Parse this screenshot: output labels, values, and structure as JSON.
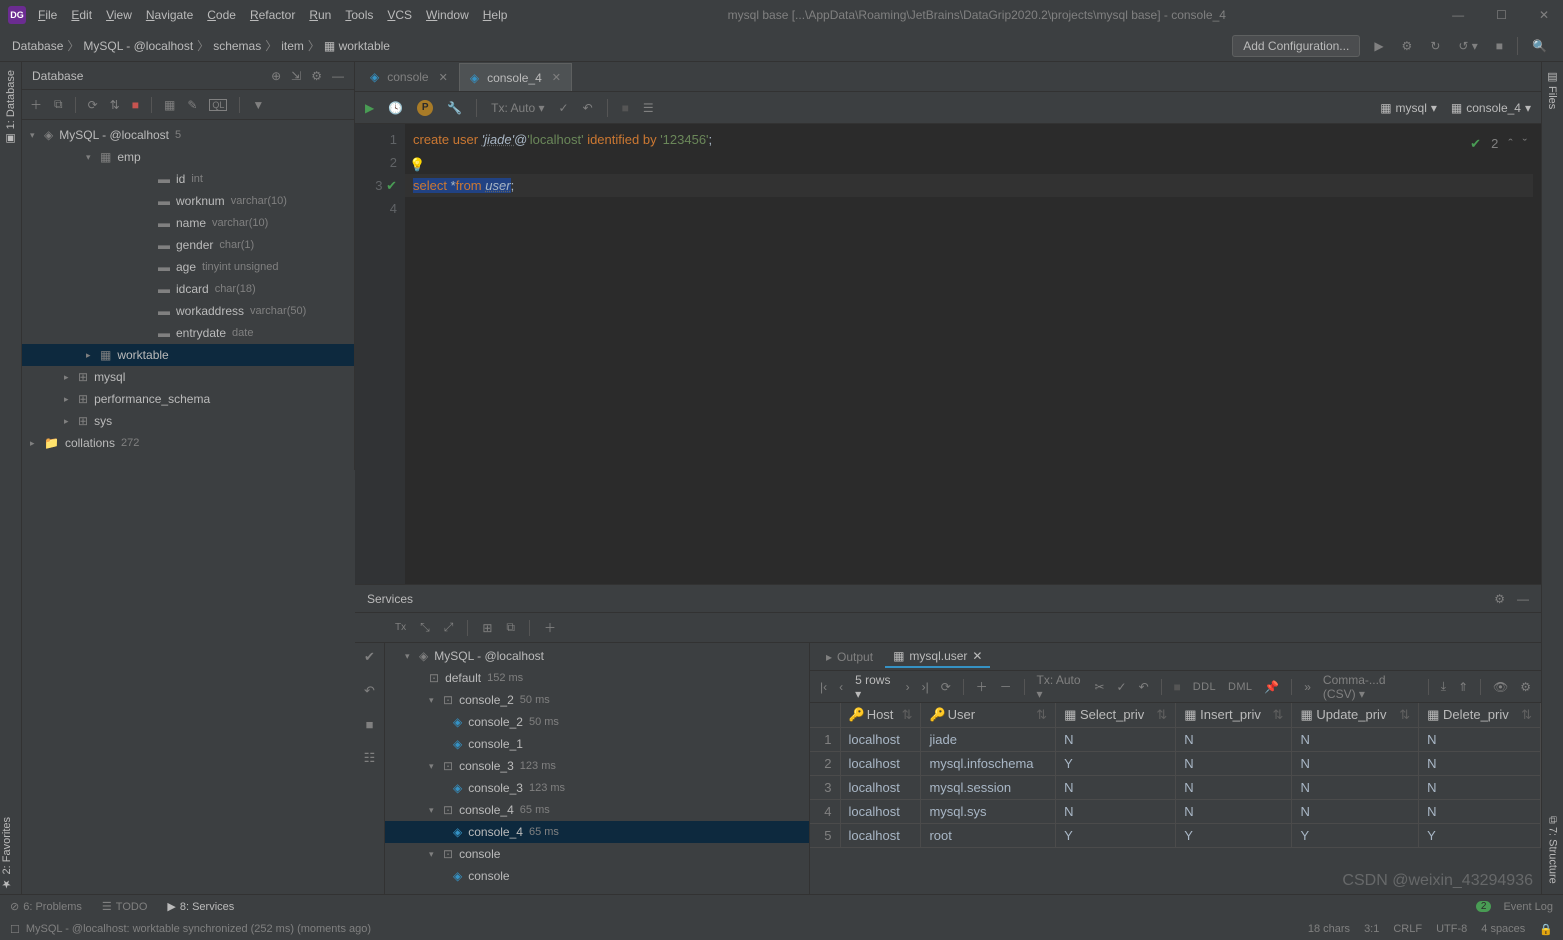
{
  "titlebar": {
    "menus": [
      "File",
      "Edit",
      "View",
      "Navigate",
      "Code",
      "Refactor",
      "Run",
      "Tools",
      "VCS",
      "Window",
      "Help"
    ],
    "title": "mysql base [...\\AppData\\Roaming\\JetBrains\\DataGrip2020.2\\projects\\mysql base] - console_4"
  },
  "breadcrumbs": [
    "Database",
    "MySQL - @localhost",
    "schemas",
    "item",
    "worktable"
  ],
  "addConfig": "Add Configuration...",
  "dbPanel": {
    "title": "Database",
    "tree": [
      {
        "level": 0,
        "caret": "▾",
        "icon": "db",
        "label": "MySQL - @localhost",
        "count": "5"
      },
      {
        "level": 2,
        "caret": "▾",
        "icon": "table",
        "label": "emp"
      },
      {
        "level": 4,
        "icon": "col",
        "label": "id",
        "type": "int"
      },
      {
        "level": 4,
        "icon": "col",
        "label": "worknum",
        "type": "varchar(10)"
      },
      {
        "level": 4,
        "icon": "col",
        "label": "name",
        "type": "varchar(10)"
      },
      {
        "level": 4,
        "icon": "col",
        "label": "gender",
        "type": "char(1)"
      },
      {
        "level": 4,
        "icon": "col",
        "label": "age",
        "type": "tinyint unsigned"
      },
      {
        "level": 4,
        "icon": "col",
        "label": "idcard",
        "type": "char(18)"
      },
      {
        "level": 4,
        "icon": "col",
        "label": "workaddress",
        "type": "varchar(50)"
      },
      {
        "level": 4,
        "icon": "col",
        "label": "entrydate",
        "type": "date"
      },
      {
        "level": 2,
        "caret": "▸",
        "icon": "table",
        "label": "worktable",
        "selected": true
      },
      {
        "level": 1,
        "caret": "▸",
        "icon": "schema",
        "label": "mysql"
      },
      {
        "level": 1,
        "caret": "▸",
        "icon": "schema",
        "label": "performance_schema"
      },
      {
        "level": 1,
        "caret": "▸",
        "icon": "schema",
        "label": "sys"
      },
      {
        "level": 0,
        "caret": "▸",
        "icon": "folder",
        "label": "collations",
        "count": "272"
      }
    ]
  },
  "editor": {
    "tabs": [
      {
        "label": "console",
        "active": false,
        "closable": true
      },
      {
        "label": "console_4",
        "active": true,
        "closable": true
      }
    ],
    "tx": "Tx: Auto",
    "datasource": "mysql",
    "schema": "console_4",
    "lines": [
      "1",
      "2",
      "3",
      "4"
    ],
    "code": {
      "l1_create": "create ",
      "l1_user": "user ",
      "l1_j": "'jiade'",
      "l1_at": "@",
      "l1_lh": "'localhost'",
      "l1_id": " identified ",
      "l1_by": "by ",
      "l1_pw": "'123456'",
      "l1_semi": ";",
      "l3_sel": "select ",
      "l3_star": "*",
      "l3_from": "from ",
      "l3_usr": "user",
      "l3_semi": ";"
    },
    "inspections": {
      "count": "2"
    }
  },
  "services": {
    "title": "Services",
    "tree": [
      {
        "level": 0,
        "caret": "▾",
        "icon": "db",
        "label": "MySQL - @localhost"
      },
      {
        "level": 1,
        "icon": "ds",
        "label": "default",
        "time": "152 ms"
      },
      {
        "level": 1,
        "caret": "▾",
        "icon": "ds",
        "label": "console_2",
        "time": "50 ms"
      },
      {
        "level": 2,
        "icon": "con",
        "label": "console_2",
        "time": "50 ms"
      },
      {
        "level": 2,
        "icon": "con",
        "label": "console_1"
      },
      {
        "level": 1,
        "caret": "▾",
        "icon": "ds",
        "label": "console_3",
        "time": "123 ms"
      },
      {
        "level": 2,
        "icon": "con",
        "label": "console_3",
        "time": "123 ms"
      },
      {
        "level": 1,
        "caret": "▾",
        "icon": "ds",
        "label": "console_4",
        "time": "65 ms"
      },
      {
        "level": 2,
        "icon": "con",
        "label": "console_4",
        "time": "65 ms",
        "selected": true
      },
      {
        "level": 1,
        "caret": "▾",
        "icon": "ds",
        "label": "console"
      },
      {
        "level": 2,
        "icon": "con",
        "label": "console"
      }
    ],
    "resultTabs": [
      {
        "label": "Output",
        "active": false
      },
      {
        "label": "mysql.user",
        "active": true,
        "closable": true
      }
    ],
    "pager": {
      "rows": "5 rows",
      "tx": "Tx: Auto",
      "ddl": "DDL",
      "dml": "DML",
      "view": "Comma-...d (CSV)"
    },
    "columns": [
      "Host",
      "User",
      "Select_priv",
      "Insert_priv",
      "Update_priv",
      "Delete_priv"
    ],
    "keyCols": [
      0,
      1
    ],
    "data": [
      [
        "localhost",
        "jiade",
        "N",
        "N",
        "N",
        "N"
      ],
      [
        "localhost",
        "mysql.infoschema",
        "Y",
        "N",
        "N",
        "N"
      ],
      [
        "localhost",
        "mysql.session",
        "N",
        "N",
        "N",
        "N"
      ],
      [
        "localhost",
        "mysql.sys",
        "N",
        "N",
        "N",
        "N"
      ],
      [
        "localhost",
        "root",
        "Y",
        "Y",
        "Y",
        "Y"
      ]
    ]
  },
  "bottomTabs": {
    "problems": "6: Problems",
    "todo": "TODO",
    "services": "8: Services",
    "eventlog": "Event Log",
    "badge": "2"
  },
  "statusbar": {
    "msg": "MySQL - @localhost: worktable synchronized (252 ms) (moments ago)",
    "chars": "18 chars",
    "pos": "3:1",
    "crlf": "CRLF",
    "enc": "UTF-8",
    "indent": "4 spaces"
  },
  "watermark": "CSDN @weixin_43294936"
}
